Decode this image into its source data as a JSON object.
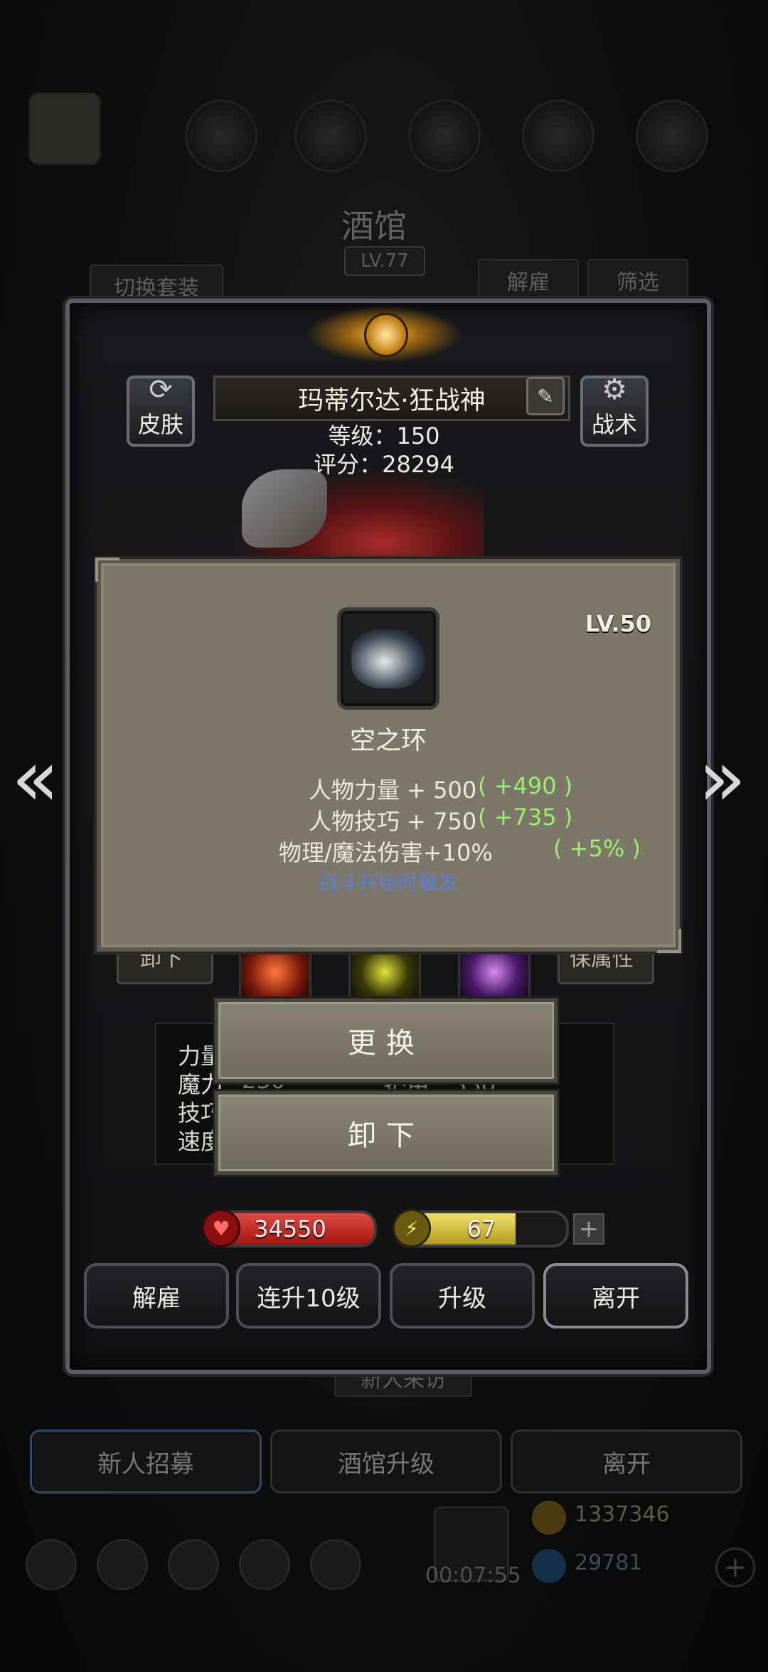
{
  "background": {
    "title": "酒馆",
    "level": "LV.77",
    "switch_outfit": "切换套装",
    "dismiss": "解雇",
    "filter": "筛选",
    "new_visitor": "新人来访",
    "bottom_buttons": [
      "新人招募",
      "酒馆升级",
      "离开"
    ],
    "gold": "1337346",
    "gems": "29781",
    "timer": "00:07:55",
    "left_button": "卸下",
    "right_button": "保属性"
  },
  "hero": {
    "skin_label": "皮肤",
    "tactics_label": "战术",
    "name": "玛蒂尔达·狂战神",
    "level_line": "等级：150",
    "score_line": "评分：28294",
    "stats": [
      "力量",
      "魔力",
      "技巧",
      "速度"
    ],
    "stat_value_partial": "230",
    "stat_value2_partial": "护甲：330"
  },
  "item": {
    "level": "LV.50",
    "name": "空之环",
    "lines": [
      {
        "text": "人物力量 + 500",
        "bonus": "( +490 )"
      },
      {
        "text": "人物技巧 + 750",
        "bonus": "( +735 )"
      },
      {
        "text": "物理/魔法伤害+10%",
        "bonus": "( +5% )"
      }
    ],
    "trigger": "战斗开始时触发"
  },
  "actions": {
    "replace": "更换",
    "unequip": "卸下"
  },
  "bars": {
    "hp": "34550",
    "energy": "67",
    "energy_fill_fraction": 0.7,
    "plus": "+"
  },
  "bottom_actions": [
    "解雇",
    "连升10级",
    "升级",
    "离开"
  ],
  "colors": {
    "hp_bar": "#c4221f",
    "energy_bar": "#d6c23a",
    "bonus_green": "#9af06a",
    "trigger_blue": "#5c7fd6",
    "tooltip_bg": "#7d776a"
  }
}
